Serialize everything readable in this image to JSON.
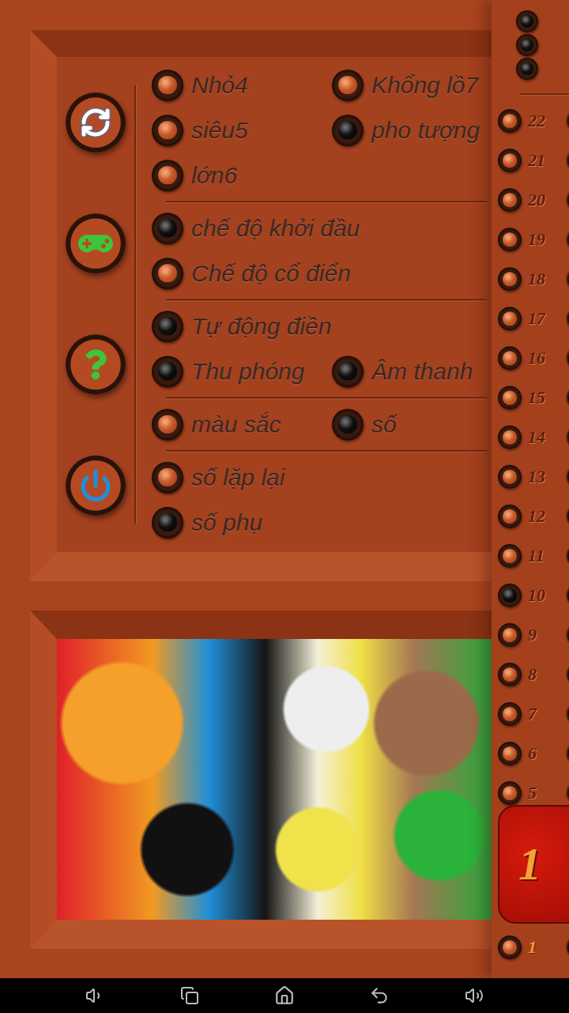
{
  "settings_groups": [
    {
      "name": "size",
      "rows": [
        [
          {
            "label": "Nhỏ4",
            "selected": false
          },
          {
            "label": "Khổng lồ7",
            "selected": false
          }
        ],
        [
          {
            "label": "siêu5",
            "selected": false
          },
          {
            "label": "pho tượng",
            "selected": true
          }
        ],
        [
          {
            "label": "lớn6",
            "selected": false
          }
        ]
      ]
    },
    {
      "name": "mode",
      "rows": [
        [
          {
            "label": "chế độ khởi đầu",
            "selected": true
          }
        ],
        [
          {
            "label": "Chế độ cổ điển",
            "selected": false
          }
        ]
      ]
    },
    {
      "name": "options",
      "rows": [
        [
          {
            "label": "Tự động điền",
            "selected": true
          }
        ],
        [
          {
            "label": "Thu phóng",
            "selected": true
          },
          {
            "label": "Âm thanh",
            "selected": true
          }
        ]
      ]
    },
    {
      "name": "display",
      "rows": [
        [
          {
            "label": "màu sắc",
            "selected": false
          },
          {
            "label": "số",
            "selected": true
          }
        ]
      ]
    },
    {
      "name": "numbers",
      "rows": [
        [
          {
            "label": "số lặp lại",
            "selected": false
          }
        ],
        [
          {
            "label": "số phụ",
            "selected": true
          }
        ]
      ]
    }
  ],
  "header_radios": [
    {
      "selected": true
    },
    {
      "selected": true
    },
    {
      "selected": true
    }
  ],
  "levels": [
    {
      "label": "22",
      "selected": false,
      "current": false
    },
    {
      "label": "21",
      "selected": false,
      "current": false
    },
    {
      "label": "20",
      "selected": false,
      "current": false
    },
    {
      "label": "19",
      "selected": false,
      "current": false
    },
    {
      "label": "18",
      "selected": false,
      "current": false
    },
    {
      "label": "17",
      "selected": false,
      "current": false
    },
    {
      "label": "16",
      "selected": false,
      "current": false
    },
    {
      "label": "15",
      "selected": false,
      "current": false
    },
    {
      "label": "14",
      "selected": false,
      "current": false
    },
    {
      "label": "13",
      "selected": false,
      "current": false
    },
    {
      "label": "12",
      "selected": false,
      "current": false
    },
    {
      "label": "11",
      "selected": false,
      "current": false
    },
    {
      "label": "10",
      "selected": true,
      "current": false
    },
    {
      "label": "9",
      "selected": false,
      "current": false
    },
    {
      "label": "8",
      "selected": false,
      "current": false
    },
    {
      "label": "7",
      "selected": false,
      "current": false
    },
    {
      "label": "6",
      "selected": false,
      "current": false
    },
    {
      "label": "5",
      "selected": false,
      "current": false
    }
  ],
  "bottom_levels": [
    {
      "label": "1",
      "selected": false,
      "current": true
    }
  ],
  "current_value": "1"
}
